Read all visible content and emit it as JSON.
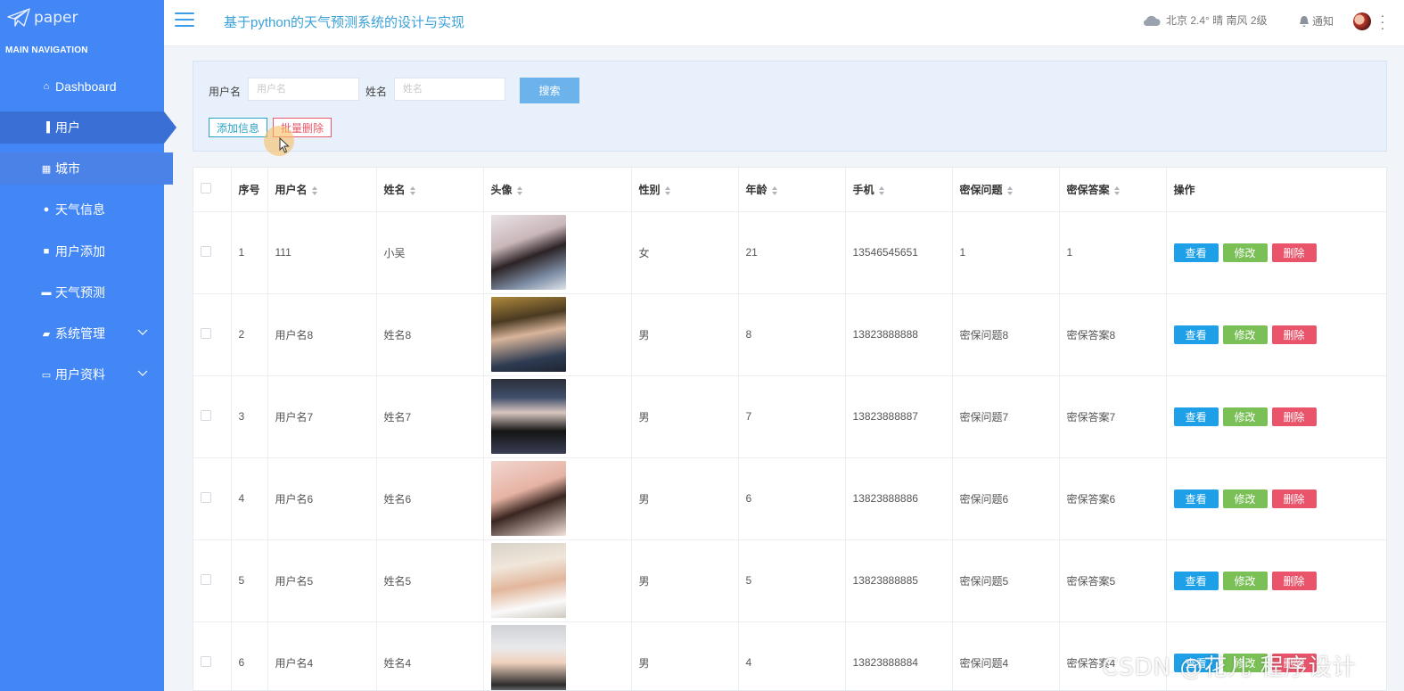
{
  "sidebar": {
    "logo_text": "paper",
    "caption": "MAIN NAVIGATION",
    "items": [
      {
        "label": "Dashboard",
        "icon": "home-icon"
      },
      {
        "label": "用户",
        "icon": "bar-chart-icon"
      },
      {
        "label": "城市",
        "icon": "grid-icon"
      },
      {
        "label": "天气信息",
        "icon": "user-icon"
      },
      {
        "label": "用户添加",
        "icon": "add-user-icon"
      },
      {
        "label": "天气预测",
        "icon": "comment-icon"
      },
      {
        "label": "系统管理",
        "icon": "briefcase-icon"
      },
      {
        "label": "用户资料",
        "icon": "id-card-icon"
      }
    ]
  },
  "header": {
    "title": "基于python的天气预测系统的设计与实现",
    "weather": "北京  2.4°  晴  南风  2级",
    "notify": "通知"
  },
  "search": {
    "username_label": "用户名",
    "username_placeholder": "用户名",
    "name_label": "姓名",
    "name_placeholder": "姓名",
    "search_button": "搜索",
    "add_button": "添加信息",
    "batch_delete_button": "批量删除"
  },
  "table": {
    "headers": [
      "序号",
      "用户名",
      "姓名",
      "头像",
      "性别",
      "年龄",
      "手机",
      "密保问题",
      "密保答案",
      "操作"
    ],
    "rows": [
      {
        "no": "1",
        "username": "111",
        "name": "小吴",
        "gender": "女",
        "age": "21",
        "phone": "13546545651",
        "question": "1",
        "answer": "1"
      },
      {
        "no": "2",
        "username": "用户名8",
        "name": "姓名8",
        "gender": "男",
        "age": "8",
        "phone": "13823888888",
        "question": "密保问题8",
        "answer": "密保答案8"
      },
      {
        "no": "3",
        "username": "用户名7",
        "name": "姓名7",
        "gender": "男",
        "age": "7",
        "phone": "13823888887",
        "question": "密保问题7",
        "answer": "密保答案7"
      },
      {
        "no": "4",
        "username": "用户名6",
        "name": "姓名6",
        "gender": "男",
        "age": "6",
        "phone": "13823888886",
        "question": "密保问题6",
        "answer": "密保答案6"
      },
      {
        "no": "5",
        "username": "用户名5",
        "name": "姓名5",
        "gender": "男",
        "age": "5",
        "phone": "13823888885",
        "question": "密保问题5",
        "answer": "密保答案5"
      },
      {
        "no": "6",
        "username": "用户名4",
        "name": "姓名4",
        "gender": "男",
        "age": "4",
        "phone": "13823888884",
        "question": "密保问题4",
        "answer": "密保答案4"
      }
    ],
    "actions": {
      "view": "查看",
      "edit": "修改",
      "delete": "删除"
    }
  },
  "watermark": "CSDN @花儿  程序设计",
  "colors": {
    "sidebar": "#4287f5",
    "accent": "#3aa1d8",
    "view": "#1ea0e8",
    "edit": "#7ac057",
    "delete": "#e9546b"
  }
}
